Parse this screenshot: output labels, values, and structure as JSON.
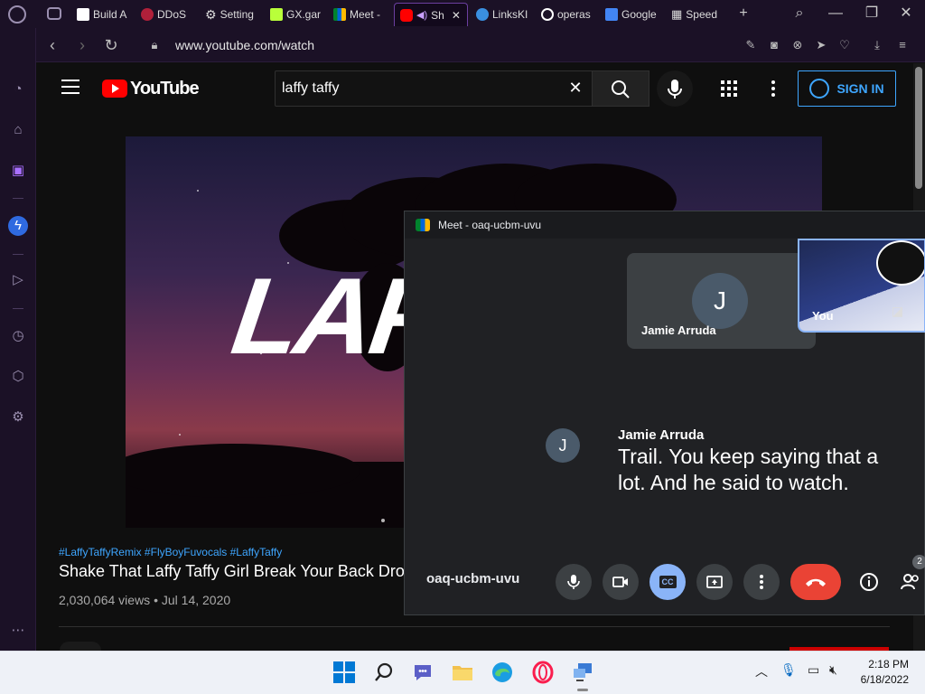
{
  "browser": {
    "tabs": [
      {
        "label": "Build A",
        "icon": "roblox-icon"
      },
      {
        "label": "DDoS",
        "icon": "ddos-icon"
      },
      {
        "label": "Setting",
        "icon": "gear-icon"
      },
      {
        "label": "GX.gar",
        "icon": "gx-games-icon"
      },
      {
        "label": "Meet -",
        "icon": "google-meet-icon"
      },
      {
        "label": "Sh",
        "icon": "youtube-icon",
        "active": true
      },
      {
        "label": "LinksKI",
        "icon": "linkskip-icon"
      },
      {
        "label": "operas",
        "icon": "opera-icon"
      },
      {
        "label": "Google",
        "icon": "google-translate-icon"
      },
      {
        "label": "Speed",
        "icon": "speed-dial-icon"
      }
    ],
    "url": "www.youtube.com/watch"
  },
  "youtube": {
    "logo_text": "YouTube",
    "search_value": "laffy taffy",
    "sign_in_label": "SIGN IN",
    "video_overlay_text": "LAFF",
    "hashtags": "#LaffyTaffyRemix #FlyBoyFuvocals #LaffyTaffy",
    "video_title": "Shake That Laffy Taffy Girl Break Your Back Drop",
    "views": "2,030,064 views",
    "date": "Jul 14, 2020",
    "meta_sep": " • "
  },
  "meet": {
    "window_title": "Meet - oaq-ucbm-uvu",
    "participant_initial": "J",
    "participant_name": "Jamie Arruda",
    "self_label": "You",
    "caption_speaker": "Jamie Arruda",
    "caption_text": "Trail. You keep saying that a lot. And he said to watch.",
    "meeting_code": "oaq-ucbm-uvu",
    "people_count": "2",
    "cc_label": "CC"
  },
  "taskbar": {
    "time": "2:18 PM",
    "date": "6/18/2022"
  },
  "colors": {
    "youtube_red": "#ff0000",
    "link_blue": "#3ea6ff",
    "meet_end_red": "#ea4335",
    "meet_cc_blue": "#8ab4f8",
    "opera_bg": "#1b1126"
  }
}
